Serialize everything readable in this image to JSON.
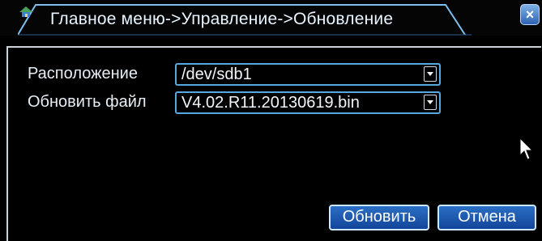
{
  "window": {
    "title": "Главное меню->Управление->Обновление",
    "close_glyph": "×"
  },
  "form": {
    "location_label": "Расположение",
    "location_value": "/dev/sdb1",
    "file_label": "Обновить файл",
    "file_value": "V4.02.R11.20130619.bin"
  },
  "buttons": {
    "update": "Обновить",
    "cancel": "Отмена"
  },
  "icons": {
    "title_icon": "home-icon",
    "close_icon": "close-icon",
    "dropdown_icon": "chevron-down-icon",
    "cursor_icon": "mouse-pointer-icon"
  },
  "colors": {
    "accent": "#58a7df",
    "button": "#1d5bb0",
    "background": "#000000"
  }
}
